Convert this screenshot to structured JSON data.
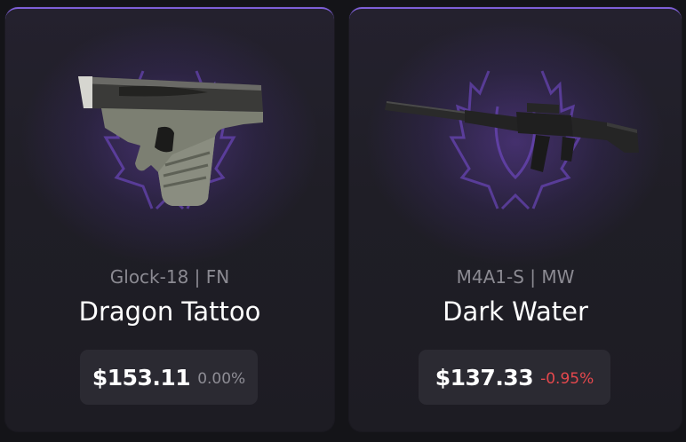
{
  "cards": [
    {
      "weapon": "Glock-18 | FN",
      "skin": "Dragon Tattoo",
      "price": "$153.11",
      "change": "0.00%",
      "change_color": "#8e8d95",
      "image_icon": "glock-pistol-icon"
    },
    {
      "weapon": "M4A1-S | MW",
      "skin": "Dark Water",
      "price": "$137.33",
      "change": "-0.95%",
      "change_color": "#e5484d",
      "image_icon": "m4a1s-rifle-icon"
    }
  ],
  "colors": {
    "accent": "#7e5fd6",
    "background": "#141418",
    "card": "#1f1e26",
    "price_box": "#2b2a32",
    "negative": "#e5484d"
  }
}
